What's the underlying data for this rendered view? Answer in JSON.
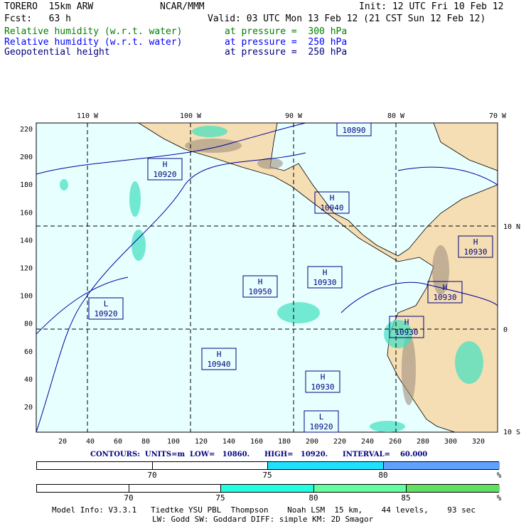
{
  "header": {
    "model": "TORERO  15km ARW",
    "org": "NCAR/MMM",
    "init": "Init: 12 UTC Fri 10 Feb 12",
    "fcst": "Fcst:   63 h",
    "valid": "Valid: 03 UTC Mon 13 Feb 12 (21 CST Sun 12 Feb 12)"
  },
  "fields": [
    {
      "name": "Relative humidity (w.r.t. water)",
      "level": "at pressure =  300 hPa",
      "color": "#008000"
    },
    {
      "name": "Relative humidity (w.r.t. water)",
      "level": "at pressure =  250 hPa",
      "color": "#0000ff"
    },
    {
      "name": "Geopotential height",
      "level": "at pressure =  250 hPa",
      "color": "#000080"
    }
  ],
  "axes": {
    "top": [
      "110 W",
      "100 W",
      "90 W",
      "80 W",
      "70 W"
    ],
    "left": [
      "220",
      "200",
      "180",
      "160",
      "140",
      "120",
      "100",
      "80",
      "60",
      "40",
      "20"
    ],
    "bottom": [
      "20",
      "40",
      "60",
      "80",
      "100",
      "120",
      "140",
      "160",
      "180",
      "200",
      "220",
      "240",
      "260",
      "280",
      "300",
      "320"
    ],
    "right": [
      "10 N",
      "0",
      "10 S"
    ]
  },
  "centers": [
    {
      "type": "",
      "value": "10890"
    },
    {
      "type": "H",
      "value": "10920"
    },
    {
      "type": "H",
      "value": "10940"
    },
    {
      "type": "H",
      "value": "10930"
    },
    {
      "type": "H",
      "value": "10930"
    },
    {
      "type": "H",
      "value": "10950"
    },
    {
      "type": "L",
      "value": "10920"
    },
    {
      "type": "H",
      "value": "10930"
    },
    {
      "type": "H",
      "value": "10930"
    },
    {
      "type": "H",
      "value": "10940"
    },
    {
      "type": "H",
      "value": "10930"
    },
    {
      "type": "L",
      "value": "10920"
    }
  ],
  "contours": "CONTOURS:  UNITS=m  LOW=   10860.      HIGH=   10920.      INTERVAL=    60.000",
  "legend1": {
    "labels": [
      "70",
      "75",
      "80",
      "%"
    ],
    "colors": [
      "#ffffff",
      "#ffffff",
      "#20e0ff",
      "#60a0ff"
    ]
  },
  "legend2": {
    "labels": [
      "70",
      "75",
      "80",
      "85",
      "%"
    ],
    "colors": [
      "#ffffff",
      "#ffffff",
      "#20ffe0",
      "#60ff9f",
      "#60e060"
    ]
  },
  "footer": {
    "line1": "Model Info: V3.3.1   Tiedtke YSU PBL  Thompson    Noah LSM  15 km,    44 levels,    93 sec",
    "line2": "LW: Godd SW: Goddard DIFF: simple KM: 2D Smagor"
  }
}
